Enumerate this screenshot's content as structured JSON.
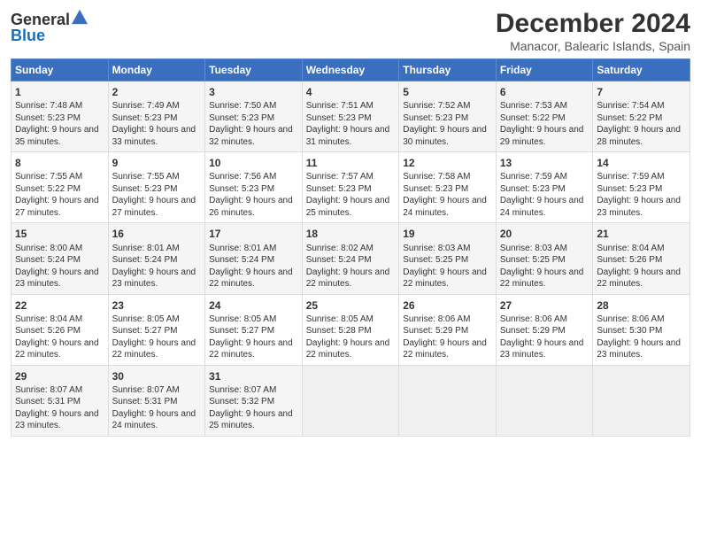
{
  "header": {
    "logo_general": "General",
    "logo_blue": "Blue",
    "main_title": "December 2024",
    "subtitle": "Manacor, Balearic Islands, Spain"
  },
  "days_header": [
    "Sunday",
    "Monday",
    "Tuesday",
    "Wednesday",
    "Thursday",
    "Friday",
    "Saturday"
  ],
  "weeks": [
    [
      {
        "day": "1",
        "sunrise": "7:48 AM",
        "sunset": "5:23 PM",
        "daylight": "9 hours and 35 minutes."
      },
      {
        "day": "2",
        "sunrise": "7:49 AM",
        "sunset": "5:23 PM",
        "daylight": "9 hours and 33 minutes."
      },
      {
        "day": "3",
        "sunrise": "7:50 AM",
        "sunset": "5:23 PM",
        "daylight": "9 hours and 32 minutes."
      },
      {
        "day": "4",
        "sunrise": "7:51 AM",
        "sunset": "5:23 PM",
        "daylight": "9 hours and 31 minutes."
      },
      {
        "day": "5",
        "sunrise": "7:52 AM",
        "sunset": "5:23 PM",
        "daylight": "9 hours and 30 minutes."
      },
      {
        "day": "6",
        "sunrise": "7:53 AM",
        "sunset": "5:22 PM",
        "daylight": "9 hours and 29 minutes."
      },
      {
        "day": "7",
        "sunrise": "7:54 AM",
        "sunset": "5:22 PM",
        "daylight": "9 hours and 28 minutes."
      }
    ],
    [
      {
        "day": "8",
        "sunrise": "7:55 AM",
        "sunset": "5:22 PM",
        "daylight": "9 hours and 27 minutes."
      },
      {
        "day": "9",
        "sunrise": "7:55 AM",
        "sunset": "5:23 PM",
        "daylight": "9 hours and 27 minutes."
      },
      {
        "day": "10",
        "sunrise": "7:56 AM",
        "sunset": "5:23 PM",
        "daylight": "9 hours and 26 minutes."
      },
      {
        "day": "11",
        "sunrise": "7:57 AM",
        "sunset": "5:23 PM",
        "daylight": "9 hours and 25 minutes."
      },
      {
        "day": "12",
        "sunrise": "7:58 AM",
        "sunset": "5:23 PM",
        "daylight": "9 hours and 24 minutes."
      },
      {
        "day": "13",
        "sunrise": "7:59 AM",
        "sunset": "5:23 PM",
        "daylight": "9 hours and 24 minutes."
      },
      {
        "day": "14",
        "sunrise": "7:59 AM",
        "sunset": "5:23 PM",
        "daylight": "9 hours and 23 minutes."
      }
    ],
    [
      {
        "day": "15",
        "sunrise": "8:00 AM",
        "sunset": "5:24 PM",
        "daylight": "9 hours and 23 minutes."
      },
      {
        "day": "16",
        "sunrise": "8:01 AM",
        "sunset": "5:24 PM",
        "daylight": "9 hours and 23 minutes."
      },
      {
        "day": "17",
        "sunrise": "8:01 AM",
        "sunset": "5:24 PM",
        "daylight": "9 hours and 22 minutes."
      },
      {
        "day": "18",
        "sunrise": "8:02 AM",
        "sunset": "5:24 PM",
        "daylight": "9 hours and 22 minutes."
      },
      {
        "day": "19",
        "sunrise": "8:03 AM",
        "sunset": "5:25 PM",
        "daylight": "9 hours and 22 minutes."
      },
      {
        "day": "20",
        "sunrise": "8:03 AM",
        "sunset": "5:25 PM",
        "daylight": "9 hours and 22 minutes."
      },
      {
        "day": "21",
        "sunrise": "8:04 AM",
        "sunset": "5:26 PM",
        "daylight": "9 hours and 22 minutes."
      }
    ],
    [
      {
        "day": "22",
        "sunrise": "8:04 AM",
        "sunset": "5:26 PM",
        "daylight": "9 hours and 22 minutes."
      },
      {
        "day": "23",
        "sunrise": "8:05 AM",
        "sunset": "5:27 PM",
        "daylight": "9 hours and 22 minutes."
      },
      {
        "day": "24",
        "sunrise": "8:05 AM",
        "sunset": "5:27 PM",
        "daylight": "9 hours and 22 minutes."
      },
      {
        "day": "25",
        "sunrise": "8:05 AM",
        "sunset": "5:28 PM",
        "daylight": "9 hours and 22 minutes."
      },
      {
        "day": "26",
        "sunrise": "8:06 AM",
        "sunset": "5:29 PM",
        "daylight": "9 hours and 22 minutes."
      },
      {
        "day": "27",
        "sunrise": "8:06 AM",
        "sunset": "5:29 PM",
        "daylight": "9 hours and 23 minutes."
      },
      {
        "day": "28",
        "sunrise": "8:06 AM",
        "sunset": "5:30 PM",
        "daylight": "9 hours and 23 minutes."
      }
    ],
    [
      {
        "day": "29",
        "sunrise": "8:07 AM",
        "sunset": "5:31 PM",
        "daylight": "9 hours and 23 minutes."
      },
      {
        "day": "30",
        "sunrise": "8:07 AM",
        "sunset": "5:31 PM",
        "daylight": "9 hours and 24 minutes."
      },
      {
        "day": "31",
        "sunrise": "8:07 AM",
        "sunset": "5:32 PM",
        "daylight": "9 hours and 25 minutes."
      },
      null,
      null,
      null,
      null
    ]
  ],
  "labels": {
    "sunrise_prefix": "Sunrise: ",
    "sunset_prefix": "Sunset: ",
    "daylight_prefix": "Daylight: "
  }
}
